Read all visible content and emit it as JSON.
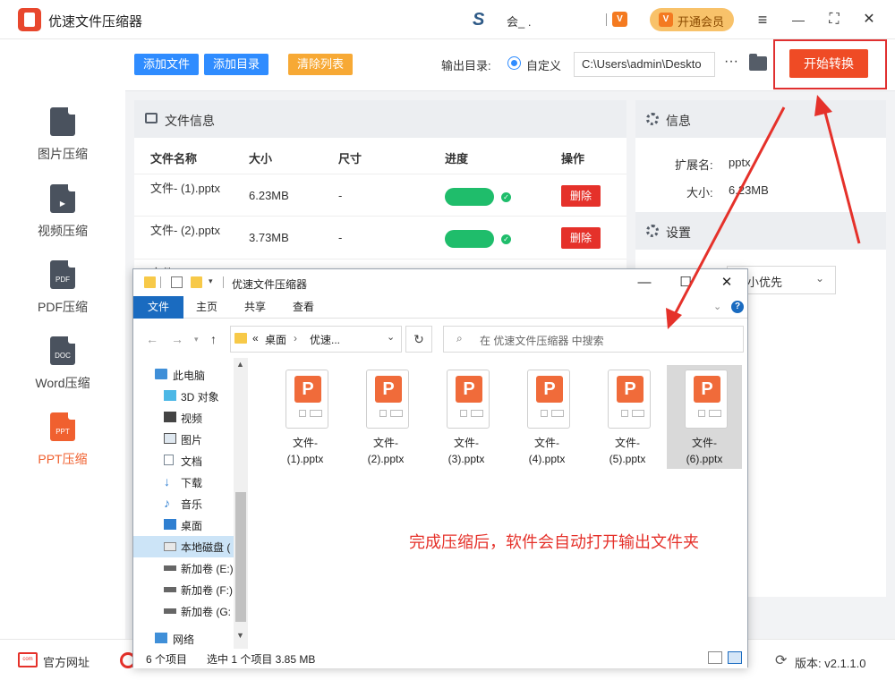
{
  "app": {
    "title": "优速文件压缩器",
    "user_name": "会_ .",
    "user_logo": "S",
    "vip_mini": "V",
    "vip_button": "开通会员",
    "controls": {
      "menu": "≡",
      "minimize": "—",
      "maximize": "⛶",
      "close": "✕"
    }
  },
  "sidebar": {
    "items": [
      {
        "label": "图片压缩",
        "icon": "image-file-icon",
        "tag": ""
      },
      {
        "label": "视频压缩",
        "icon": "video-file-icon",
        "tag": "▶"
      },
      {
        "label": "PDF压缩",
        "icon": "pdf-file-icon",
        "tag": "PDF"
      },
      {
        "label": "Word压缩",
        "icon": "doc-file-icon",
        "tag": "DOC"
      },
      {
        "label": "PPT压缩",
        "icon": "ppt-file-icon",
        "tag": "PPT"
      }
    ],
    "active_index": 4
  },
  "toolbar": {
    "add_file": "添加文件",
    "add_dir": "添加目录",
    "clear_list": "清除列表",
    "output_label": "输出目录:",
    "custom_label": "自定义",
    "output_path": "C:\\Users\\admin\\Deskto",
    "more": "···",
    "start": "开始转换",
    "colors": {
      "blue": "#2f8cff",
      "orange": "#f7a935",
      "start": "#ef4b25"
    }
  },
  "file_panel": {
    "title": "文件信息",
    "columns": [
      "文件名称",
      "大小",
      "尺寸",
      "进度",
      "操作"
    ],
    "rows": [
      {
        "name": "文件- (1).pptx",
        "size": "6.23MB",
        "dimension": "-",
        "progress": 1.0,
        "action": "删除"
      },
      {
        "name": "文件- (2).pptx",
        "size": "3.73MB",
        "dimension": "-",
        "progress": 1.0,
        "action": "删除"
      }
    ],
    "partial_row_name": "文件- (3)"
  },
  "info_panel": {
    "title": "信息",
    "ext_label": "扩展名:",
    "ext_value": "pptx",
    "size_label": "大小:",
    "size_value": "6.23MB"
  },
  "settings_panel": {
    "title": "设置",
    "mode_value": "小优先"
  },
  "footer": {
    "site_label": "官方网址",
    "site_icon_text": "com",
    "version": "版本: v2.1.1.0"
  },
  "explorer": {
    "title": "优速文件压缩器",
    "ribbon_tabs": [
      "文件",
      "主页",
      "共享",
      "查看"
    ],
    "breadcrumb": [
      "桌面",
      "优速..."
    ],
    "breadcrumb_prefix": "«",
    "search_placeholder": "在 优速文件压缩器 中搜索",
    "nav_items": [
      {
        "label": "此电脑",
        "icon": "computer-icon",
        "indent": 0
      },
      {
        "label": "3D 对象",
        "icon": "3d-objects-icon",
        "indent": 1
      },
      {
        "label": "视频",
        "icon": "videos-icon",
        "indent": 1
      },
      {
        "label": "图片",
        "icon": "pictures-icon",
        "indent": 1
      },
      {
        "label": "文档",
        "icon": "documents-icon",
        "indent": 1
      },
      {
        "label": "下载",
        "icon": "downloads-icon",
        "indent": 1
      },
      {
        "label": "音乐",
        "icon": "music-icon",
        "indent": 1
      },
      {
        "label": "桌面",
        "icon": "desktop-icon",
        "indent": 1
      },
      {
        "label": "本地磁盘 (",
        "icon": "local-disk-icon",
        "indent": 1,
        "selected": true
      },
      {
        "label": "新加卷 (E:)",
        "icon": "drive-icon",
        "indent": 1
      },
      {
        "label": "新加卷 (F:)",
        "icon": "drive-icon",
        "indent": 1
      },
      {
        "label": "新加卷 (G:",
        "icon": "drive-icon",
        "indent": 1
      },
      {
        "label": "网络",
        "icon": "network-icon",
        "indent": 0
      }
    ],
    "files": [
      {
        "name_line1": "文件-",
        "name_line2": "(1).pptx"
      },
      {
        "name_line1": "文件-",
        "name_line2": "(2).pptx"
      },
      {
        "name_line1": "文件-",
        "name_line2": "(3).pptx"
      },
      {
        "name_line1": "文件-",
        "name_line2": "(4).pptx"
      },
      {
        "name_line1": "文件-",
        "name_line2": "(5).pptx"
      },
      {
        "name_line1": "文件-",
        "name_line2": "(6).pptx",
        "selected": true
      }
    ],
    "annotation": "完成压缩后，软件会自动打开输出文件夹",
    "status_count": "6 个项目",
    "status_selected": "选中 1 个项目  3.85 MB",
    "controls": {
      "minimize": "—",
      "maximize": "☐",
      "close": "✕"
    }
  }
}
